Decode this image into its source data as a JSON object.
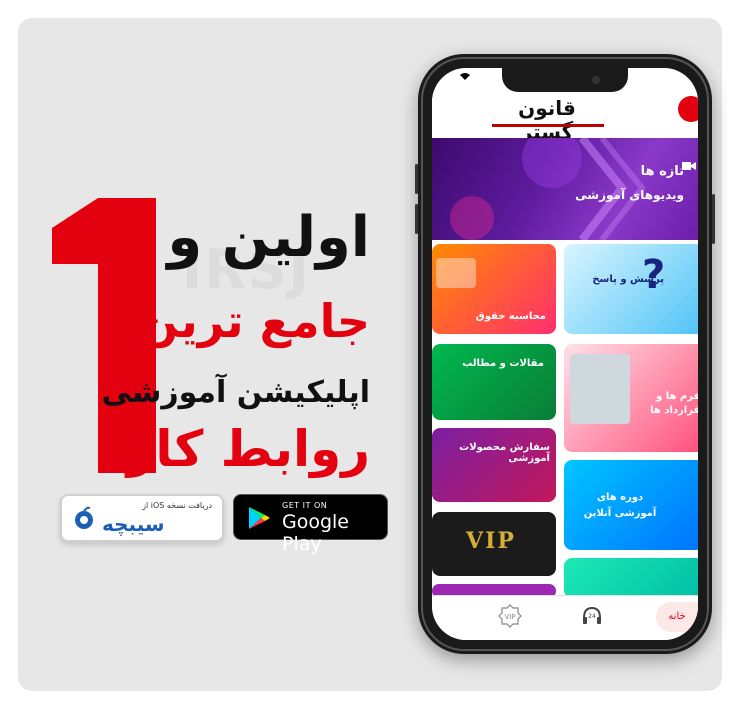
{
  "headline": {
    "line1": "اولین و",
    "line2": "جامع ترین",
    "line3": "اپلیکیشن آموزشی",
    "line4": "روابط کار"
  },
  "stores": {
    "sibche_sub": "دریافت نسخه iOS از",
    "sibche_name": "سیبچه",
    "google_small": "GET IT ON",
    "google_big": "Google Play"
  },
  "app": {
    "logo": "قانون گستر",
    "hero_line1": "تازه ها",
    "hero_line2": "ویدیوهای آموزشی",
    "tiles": [
      {
        "label": "محاسبه حقوق"
      },
      {
        "label": "پرسش و پاسخ"
      },
      {
        "label": "مقالات و مطالب"
      },
      {
        "label": "فرم ها و قرارداد ها"
      },
      {
        "label": "سفارش محصولات آموزشی"
      },
      {
        "label": "دوره های آموزشی آنلاین"
      },
      {
        "label": "VIP"
      }
    ],
    "nav_home": "خانه",
    "nav_support_num": "24",
    "nav_vip": "VIP"
  },
  "colors": {
    "accent": "#e3000f",
    "hero": "#5d1b9d",
    "background": "#e7e7e7"
  }
}
